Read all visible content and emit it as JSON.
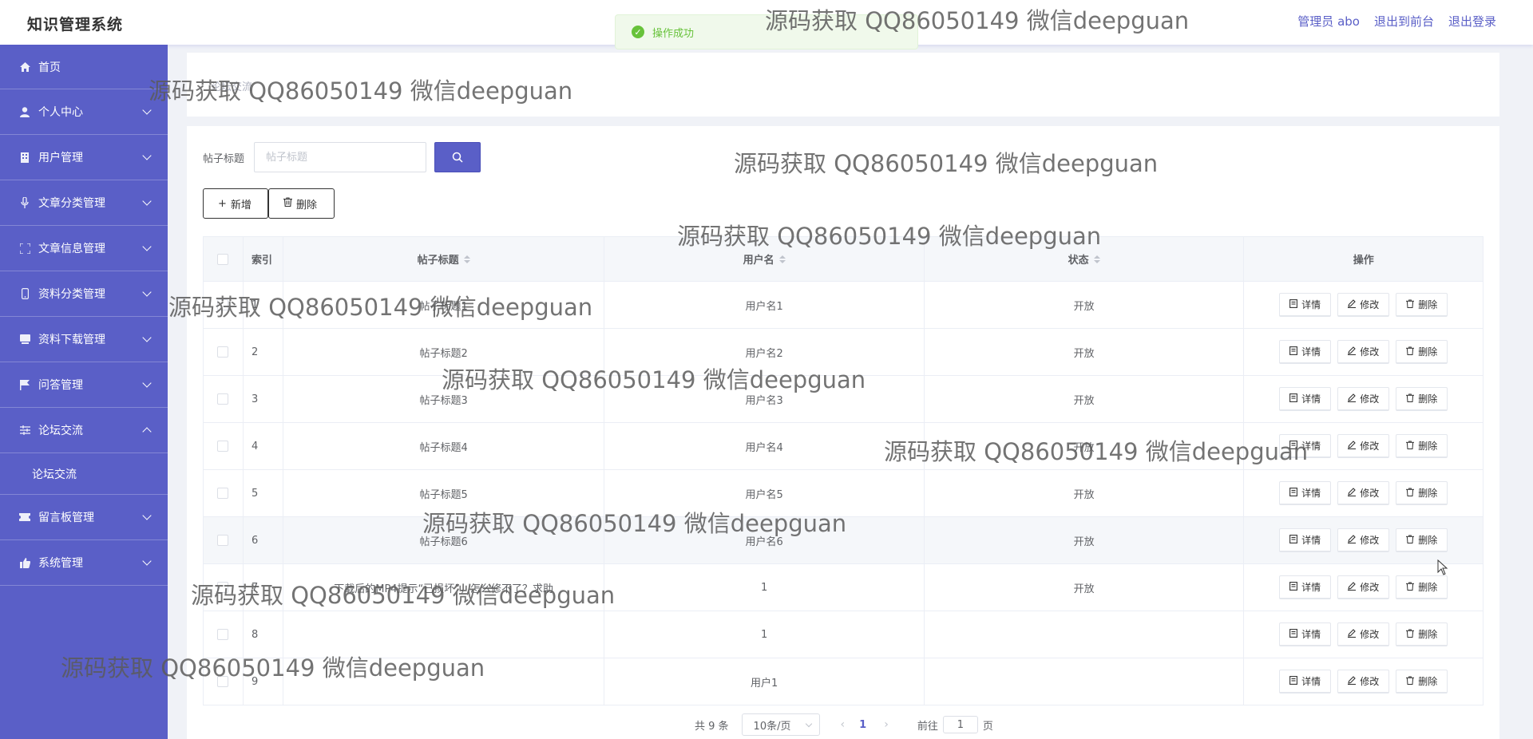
{
  "app": {
    "title": "知识管理系统",
    "header_links": [
      "管理员 abo",
      "退出到前台",
      "退出登录"
    ]
  },
  "toast": {
    "message": "操作成功"
  },
  "sidebar": {
    "items": [
      {
        "label": "首页",
        "icon": "home-icon",
        "expandable": false
      },
      {
        "label": "个人中心",
        "icon": "user-icon",
        "expandable": true
      },
      {
        "label": "用户管理",
        "icon": "building-icon",
        "expandable": true
      },
      {
        "label": "文章分类管理",
        "icon": "microphone-icon",
        "expandable": true
      },
      {
        "label": "文章信息管理",
        "icon": "fullscreen-icon",
        "expandable": true
      },
      {
        "label": "资料分类管理",
        "icon": "mobile-icon",
        "expandable": true
      },
      {
        "label": "资料下载管理",
        "icon": "database-icon",
        "expandable": true
      },
      {
        "label": "问答管理",
        "icon": "flag-icon",
        "expandable": true
      },
      {
        "label": "论坛交流",
        "icon": "sliders-icon",
        "expandable": true,
        "expanded": true,
        "children": [
          "论坛交流"
        ]
      },
      {
        "label": "留言板管理",
        "icon": "ticket-icon",
        "expandable": true
      },
      {
        "label": "系统管理",
        "icon": "thumb-icon",
        "expandable": true
      }
    ]
  },
  "breadcrumb": {
    "current": "论坛交流"
  },
  "search": {
    "label": "帖子标题",
    "placeholder": "帖子标题",
    "value": ""
  },
  "actions": {
    "add_label": "新增",
    "delete_label": "删除"
  },
  "table": {
    "headers": {
      "index": "索引",
      "title": "帖子标题",
      "username": "用户名",
      "status": "状态",
      "operations": "操作"
    },
    "op_labels": {
      "detail": "详情",
      "edit": "修改",
      "delete": "删除"
    },
    "rows": [
      {
        "index": "1",
        "title": "帖子标题1",
        "username": "用户名1",
        "status": "开放"
      },
      {
        "index": "2",
        "title": "帖子标题2",
        "username": "用户名2",
        "status": "开放"
      },
      {
        "index": "3",
        "title": "帖子标题3",
        "username": "用户名3",
        "status": "开放"
      },
      {
        "index": "4",
        "title": "帖子标题4",
        "username": "用户名4",
        "status": "开放"
      },
      {
        "index": "5",
        "title": "帖子标题5",
        "username": "用户名5",
        "status": "开放"
      },
      {
        "index": "6",
        "title": "帖子标题6",
        "username": "用户名6",
        "status": "开放"
      },
      {
        "index": "7",
        "title": "下载后的MP4提示“已损坏”，怎么修不了？求助",
        "username": "1",
        "status": "开放"
      },
      {
        "index": "8",
        "title": "",
        "username": "1",
        "status": ""
      },
      {
        "index": "9",
        "title": "",
        "username": "用户1",
        "status": ""
      }
    ]
  },
  "pagination": {
    "total_text": "共 9 条",
    "page_size": "10条/页",
    "current_page": "1",
    "goto_label": "前往",
    "goto_value": "1",
    "page_suffix": "页"
  },
  "watermark": {
    "text": "源码获取 QQ86050149 微信deepguan"
  },
  "colors": {
    "primary": "#5a5fc7",
    "success": "#67c23a"
  }
}
